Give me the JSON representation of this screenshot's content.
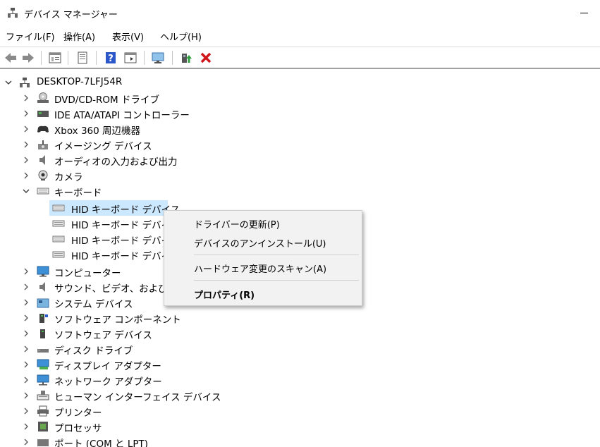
{
  "window": {
    "title": "デバイス マネージャー"
  },
  "menubar": [
    "ファイル(F)",
    "操作(A)",
    "表示(V)",
    "ヘルプ(H)"
  ],
  "toolbar": [
    "back-arrow-icon",
    "forward-arrow-icon",
    "properties-icon",
    "view-icon",
    "help-icon",
    "console-icon",
    "scan-hardware-icon",
    "update-driver-icon",
    "uninstall-icon"
  ],
  "tree": {
    "root": "DESKTOP-7LFJ54R",
    "categories": [
      "DVD/CD-ROM ドライブ",
      "IDE ATA/ATAPI コントローラー",
      "Xbox 360 周辺機器",
      "イメージング デバイス",
      "オーディオの入力および出力",
      "カメラ",
      "キーボード",
      "HID キーボード デバイス",
      "HID キーボード デバイス",
      "HID キーボード デバイス",
      "HID キーボード デバイス",
      "コンピューター",
      "サウンド、ビデオ、およびゲー",
      "システム デバイス",
      "ソフトウェア コンポーネント",
      "ソフトウェア デバイス",
      "ディスク ドライブ",
      "ディスプレイ アダプター",
      "ネットワーク アダプター",
      "ヒューマン インターフェイス デバイス",
      "プリンター",
      "プロセッサ",
      "ポート (COM と LPT)"
    ]
  },
  "context_menu": {
    "items": [
      "ドライバーの更新(P)",
      "デバイスのアンインストール(U)",
      "ハードウェア変更のスキャン(A)",
      "プロパティ(R)"
    ]
  },
  "colors": {
    "selection": "#cce8ff",
    "delete": "#d0161a",
    "help": "#2b57c8"
  }
}
